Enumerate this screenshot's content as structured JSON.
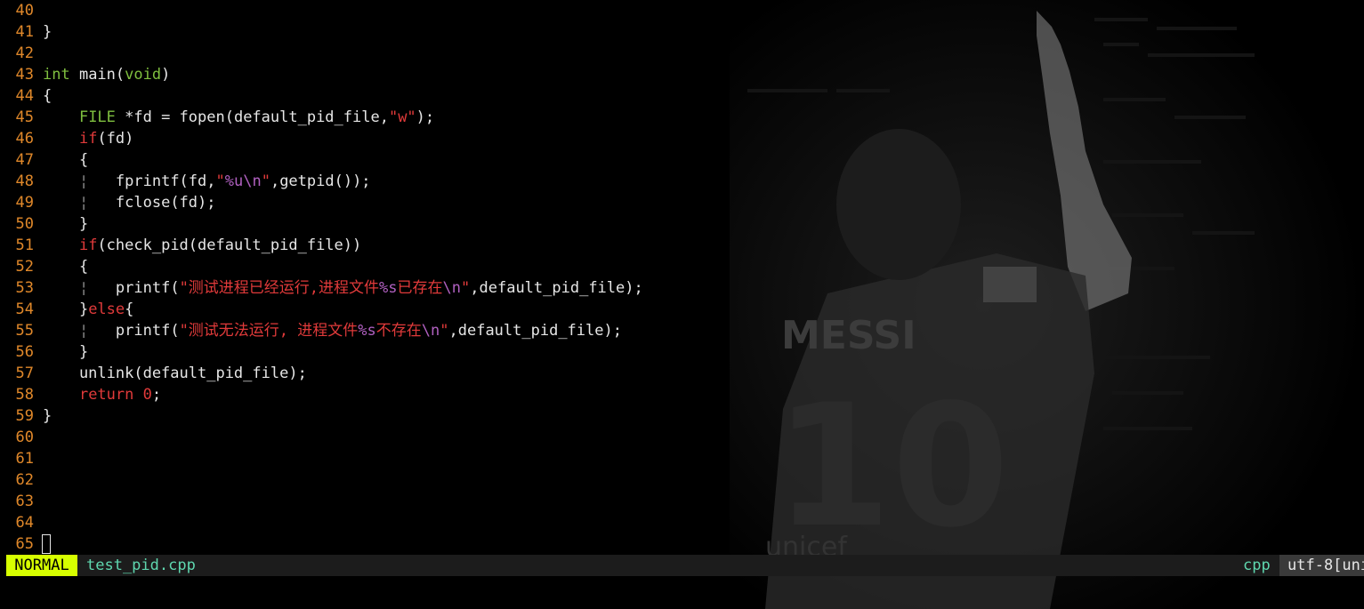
{
  "editor": {
    "lines": [
      {
        "num": "40",
        "tokens": []
      },
      {
        "num": "41",
        "tokens": [
          {
            "t": "}",
            "c": ""
          }
        ]
      },
      {
        "num": "42",
        "tokens": []
      },
      {
        "num": "43",
        "tokens": [
          {
            "t": "int",
            "c": "kw-type"
          },
          {
            "t": " main(",
            "c": ""
          },
          {
            "t": "void",
            "c": "kw-type"
          },
          {
            "t": ")",
            "c": ""
          }
        ]
      },
      {
        "num": "44",
        "tokens": [
          {
            "t": "{",
            "c": ""
          }
        ]
      },
      {
        "num": "45",
        "tokens": [
          {
            "t": "    ",
            "c": ""
          },
          {
            "t": "FILE",
            "c": "kw-type"
          },
          {
            "t": " *fd = fopen(default_pid_file,",
            "c": ""
          },
          {
            "t": "\"w\"",
            "c": "str"
          },
          {
            "t": ");",
            "c": ""
          }
        ]
      },
      {
        "num": "46",
        "tokens": [
          {
            "t": "    ",
            "c": ""
          },
          {
            "t": "if",
            "c": "kw-ctrl"
          },
          {
            "t": "(fd)",
            "c": ""
          }
        ]
      },
      {
        "num": "47",
        "tokens": [
          {
            "t": "    {",
            "c": ""
          }
        ]
      },
      {
        "num": "48",
        "tokens": [
          {
            "t": "    ",
            "c": ""
          },
          {
            "t": "¦",
            "c": "guide"
          },
          {
            "t": "   fprintf(fd,",
            "c": ""
          },
          {
            "t": "\"",
            "c": "str"
          },
          {
            "t": "%u\\n",
            "c": "esc"
          },
          {
            "t": "\"",
            "c": "str"
          },
          {
            "t": ",getpid());",
            "c": ""
          }
        ]
      },
      {
        "num": "49",
        "tokens": [
          {
            "t": "    ",
            "c": ""
          },
          {
            "t": "¦",
            "c": "guide"
          },
          {
            "t": "   fclose(fd);",
            "c": ""
          }
        ]
      },
      {
        "num": "50",
        "tokens": [
          {
            "t": "    }",
            "c": ""
          }
        ]
      },
      {
        "num": "51",
        "tokens": [
          {
            "t": "    ",
            "c": ""
          },
          {
            "t": "if",
            "c": "kw-ctrl"
          },
          {
            "t": "(check_pid(default_pid_file))",
            "c": ""
          }
        ]
      },
      {
        "num": "52",
        "tokens": [
          {
            "t": "    {",
            "c": ""
          }
        ]
      },
      {
        "num": "53",
        "tokens": [
          {
            "t": "    ",
            "c": ""
          },
          {
            "t": "¦",
            "c": "guide"
          },
          {
            "t": "   printf(",
            "c": ""
          },
          {
            "t": "\"测试进程已经运行,进程文件",
            "c": "str"
          },
          {
            "t": "%s",
            "c": "esc"
          },
          {
            "t": "已存在",
            "c": "str"
          },
          {
            "t": "\\n",
            "c": "esc"
          },
          {
            "t": "\"",
            "c": "str"
          },
          {
            "t": ",default_pid_file);",
            "c": ""
          }
        ]
      },
      {
        "num": "54",
        "tokens": [
          {
            "t": "    }",
            "c": ""
          },
          {
            "t": "else",
            "c": "kw-ctrl"
          },
          {
            "t": "{",
            "c": ""
          }
        ]
      },
      {
        "num": "55",
        "tokens": [
          {
            "t": "    ",
            "c": ""
          },
          {
            "t": "¦",
            "c": "guide"
          },
          {
            "t": "   printf(",
            "c": ""
          },
          {
            "t": "\"测试无法运行, 进程文件",
            "c": "str"
          },
          {
            "t": "%s",
            "c": "esc"
          },
          {
            "t": "不存在",
            "c": "str"
          },
          {
            "t": "\\n",
            "c": "esc"
          },
          {
            "t": "\"",
            "c": "str"
          },
          {
            "t": ",default_pid_file);",
            "c": ""
          }
        ]
      },
      {
        "num": "56",
        "tokens": [
          {
            "t": "    }",
            "c": ""
          }
        ]
      },
      {
        "num": "57",
        "tokens": [
          {
            "t": "    unlink(default_pid_file);",
            "c": ""
          }
        ]
      },
      {
        "num": "58",
        "tokens": [
          {
            "t": "    ",
            "c": ""
          },
          {
            "t": "return",
            "c": "kw-ctrl"
          },
          {
            "t": " ",
            "c": ""
          },
          {
            "t": "0",
            "c": "num"
          },
          {
            "t": ";",
            "c": ""
          }
        ]
      },
      {
        "num": "59",
        "tokens": [
          {
            "t": "}",
            "c": ""
          }
        ]
      },
      {
        "num": "60",
        "tokens": []
      },
      {
        "num": "61",
        "tokens": []
      },
      {
        "num": "62",
        "tokens": []
      },
      {
        "num": "63",
        "tokens": []
      },
      {
        "num": "64",
        "tokens": []
      },
      {
        "num": "65",
        "tokens": []
      }
    ]
  },
  "statusline": {
    "mode": "NORMAL",
    "filename": "test_pid.cpp",
    "filetype": "cpp",
    "encoding": "utf-8[uni"
  },
  "background": {
    "jersey_name": "MESSI",
    "jersey_number": "10",
    "sponsor": "unicef"
  },
  "colors": {
    "line_number": "#e0882a",
    "type_keyword": "#7fbf3f",
    "control_keyword": "#e03a3a",
    "string": "#e03a3a",
    "escape": "#b060c0",
    "mode_bg": "#d7ff00",
    "filename": "#5fd7af"
  }
}
